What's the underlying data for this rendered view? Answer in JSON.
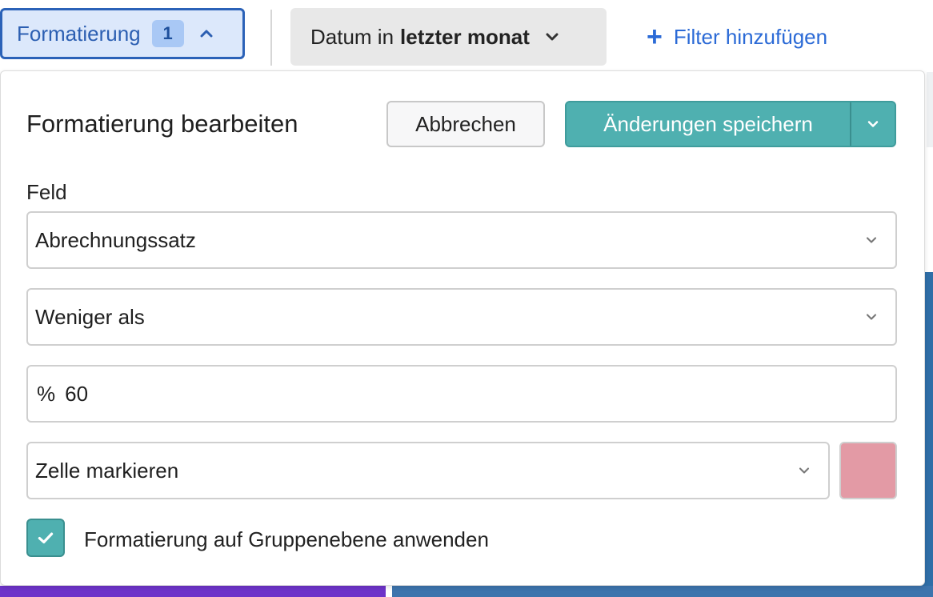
{
  "filter_bar": {
    "formatting_chip": {
      "label": "Formatierung",
      "count": "1",
      "icon": "chevron-up-icon"
    },
    "date_chip": {
      "prefix": "Datum in",
      "value": "letzter monat",
      "icon": "chevron-down-icon"
    },
    "add_filter": {
      "icon": "plus-icon",
      "label": "Filter hinzufügen"
    }
  },
  "panel": {
    "title": "Formatierung bearbeiten",
    "cancel_label": "Abbrechen",
    "save_label": "Änderungen speichern",
    "field_label": "Feld",
    "field_value": "Abrechnungssatz",
    "operator_value": "Weniger als",
    "value_prefix": "%",
    "value": "60",
    "action_value": "Zelle markieren",
    "highlight_color": "#e39aa5",
    "apply_group_checked": true,
    "apply_group_label": "Formatierung auf Gruppenebene anwenden"
  },
  "colors": {
    "accent_teal": "#4fb0b0",
    "chip_active_border": "#2b62b8",
    "link_blue": "#2b6ad6"
  }
}
